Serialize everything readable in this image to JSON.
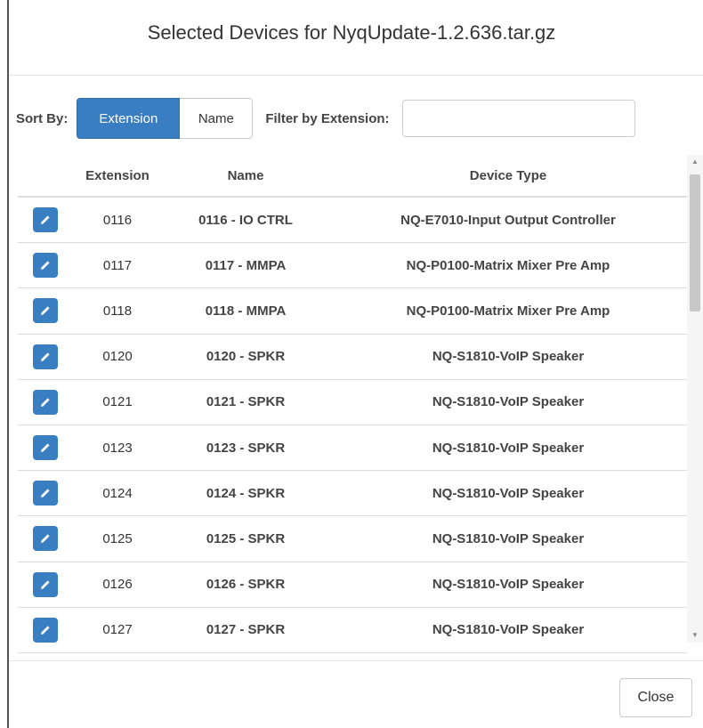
{
  "dialog": {
    "title": "Selected Devices for NyqUpdate-1.2.636.tar.gz"
  },
  "controls": {
    "sort_label": "Sort By:",
    "sort_options": [
      "Extension",
      "Name"
    ],
    "sort_selected": "Extension",
    "filter_label": "Filter by Extension:",
    "filter_value": "",
    "filter_placeholder": ""
  },
  "table": {
    "columns": [
      "",
      "Extension",
      "Name",
      "Device Type"
    ],
    "rows": [
      {
        "extension": "0116",
        "name": "0116 - IO CTRL",
        "device_type": "NQ-E7010-Input Output Controller"
      },
      {
        "extension": "0117",
        "name": "0117 - MMPA",
        "device_type": "NQ-P0100-Matrix Mixer Pre Amp"
      },
      {
        "extension": "0118",
        "name": "0118 - MMPA",
        "device_type": "NQ-P0100-Matrix Mixer Pre Amp"
      },
      {
        "extension": "0120",
        "name": "0120 - SPKR",
        "device_type": "NQ-S1810-VoIP Speaker"
      },
      {
        "extension": "0121",
        "name": "0121 - SPKR",
        "device_type": "NQ-S1810-VoIP Speaker"
      },
      {
        "extension": "0123",
        "name": "0123 - SPKR",
        "device_type": "NQ-S1810-VoIP Speaker"
      },
      {
        "extension": "0124",
        "name": "0124 - SPKR",
        "device_type": "NQ-S1810-VoIP Speaker"
      },
      {
        "extension": "0125",
        "name": "0125 - SPKR",
        "device_type": "NQ-S1810-VoIP Speaker"
      },
      {
        "extension": "0126",
        "name": "0126 - SPKR",
        "device_type": "NQ-S1810-VoIP Speaker"
      },
      {
        "extension": "0127",
        "name": "0127 - SPKR",
        "device_type": "NQ-S1810-VoIP Speaker"
      }
    ],
    "row_icon": "pencil-icon"
  },
  "footer": {
    "close_label": "Close"
  },
  "colors": {
    "accent": "#3a7ec2",
    "border": "#dddddd",
    "text": "#444444"
  }
}
